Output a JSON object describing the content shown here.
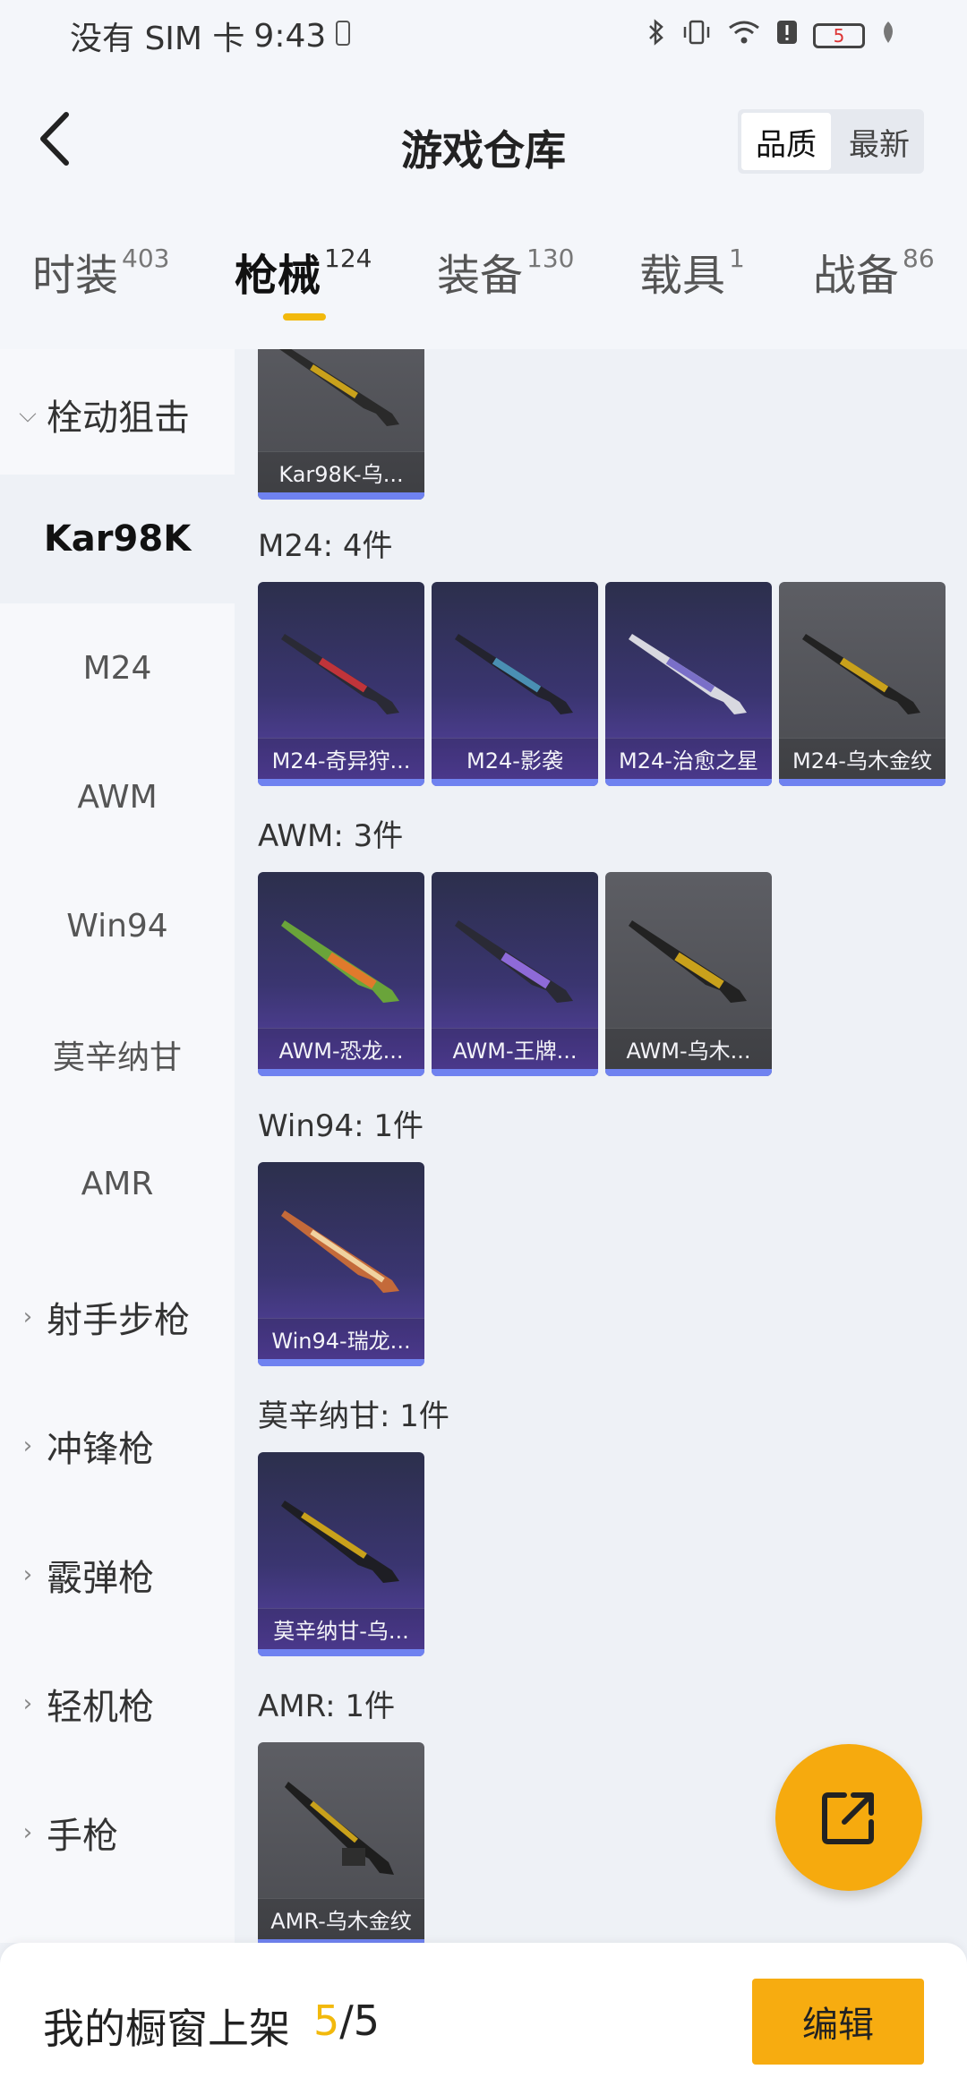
{
  "status_bar": {
    "carrier": "没有 SIM 卡",
    "time": "9:43",
    "battery": "5"
  },
  "header": {
    "title": "游戏仓库",
    "sort_options": [
      "品质",
      "最新"
    ],
    "sort_selected": "品质"
  },
  "tabs": [
    {
      "label": "时装",
      "count": "403"
    },
    {
      "label": "枪械",
      "count": "124",
      "active": true
    },
    {
      "label": "装备",
      "count": "130"
    },
    {
      "label": "载具",
      "count": "1"
    },
    {
      "label": "战备",
      "count": "86"
    }
  ],
  "sidebar": {
    "group_open": "栓动狙击",
    "items": [
      "Kar98K",
      "M24",
      "AWM",
      "Win94",
      "莫辛纳甘",
      "AMR"
    ],
    "active_item": "Kar98K",
    "groups_collapsed": [
      "射手步枪",
      "冲锋枪",
      "霰弹枪",
      "轻机枪",
      "手枪"
    ]
  },
  "sections": [
    {
      "label": "",
      "cards": [
        {
          "name": "Kar98K-乌...",
          "style": "gray"
        }
      ]
    },
    {
      "label": "M24: 4件",
      "cards": [
        {
          "name": "M24-奇异狩...",
          "style": "purple"
        },
        {
          "name": "M24-影袭",
          "style": "purple"
        },
        {
          "name": "M24-治愈之星",
          "style": "purple"
        },
        {
          "name": "M24-乌木金纹",
          "style": "gray"
        }
      ]
    },
    {
      "label": "AWM: 3件",
      "cards": [
        {
          "name": "AWM-恐龙...",
          "style": "purple"
        },
        {
          "name": "AWM-王牌...",
          "style": "purple"
        },
        {
          "name": "AWM-乌木...",
          "style": "gray"
        }
      ]
    },
    {
      "label": "Win94: 1件",
      "cards": [
        {
          "name": "Win94-瑞龙...",
          "style": "purple"
        }
      ]
    },
    {
      "label": "莫辛纳甘: 1件",
      "cards": [
        {
          "name": "莫辛纳甘-乌...",
          "style": "purple"
        }
      ]
    },
    {
      "label": "AMR: 1件",
      "cards": [
        {
          "name": "AMR-乌木金纹",
          "style": "gray"
        }
      ]
    }
  ],
  "bottom_bar": {
    "label": "我的橱窗上架",
    "count_current": "5",
    "count_total": "/5",
    "edit_label": "编辑"
  },
  "colors": {
    "accent": "#f2b90c",
    "fab": "#f6aa0e",
    "rarity_bar": "#6f82f0"
  }
}
